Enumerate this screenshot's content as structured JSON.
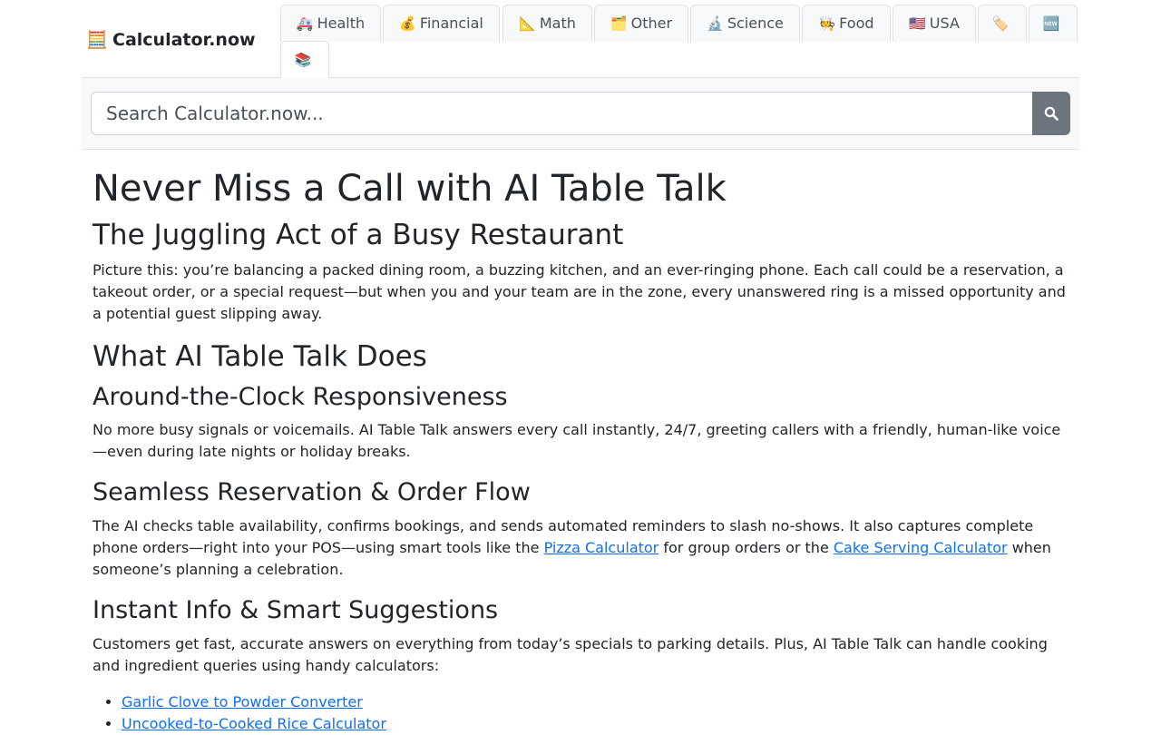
{
  "brand": {
    "icon": "🧮",
    "name": "Calculator.now"
  },
  "tabs": [
    {
      "icon": "🚑",
      "label": "Health",
      "name": "tab-health"
    },
    {
      "icon": "💰",
      "label": "Financial",
      "name": "tab-financial"
    },
    {
      "icon": "📐",
      "label": "Math",
      "name": "tab-math"
    },
    {
      "icon": "🗂️",
      "label": "Other",
      "name": "tab-other"
    },
    {
      "icon": "🔬",
      "label": "Science",
      "name": "tab-science"
    },
    {
      "icon": "🧑‍🍳",
      "label": "Food",
      "name": "tab-food"
    },
    {
      "icon": "🇺🇸",
      "label": "USA",
      "name": "tab-usa"
    },
    {
      "icon": "🏷️",
      "label": "",
      "name": "tab-tags"
    },
    {
      "icon": "🆕",
      "label": "",
      "name": "tab-new"
    },
    {
      "icon": "📚",
      "label": "",
      "name": "tab-books"
    }
  ],
  "search": {
    "placeholder": "Search Calculator.now...",
    "value": "",
    "icon": "search-icon"
  },
  "article": {
    "title": "Never Miss a Call with AI Table Talk",
    "section1_heading": "The Juggling Act of a Busy Restaurant",
    "section1_text": "Picture this: you’re balancing a packed dining room, a buzzing kitchen, and an ever-ringing phone. Each call could be a reservation, a takeout order, or a special request—but when you and your team are in the zone, every unanswered ring is a missed opportunity and a potential guest slipping away.",
    "section2_heading": "What AI Table Talk Does",
    "sub1_heading": "Around-the-Clock Responsiveness",
    "sub1_text": "No more busy signals or voicemails. AI Table Talk answers every call instantly, 24/7, greeting callers with a friendly, human-like voice—even during late nights or holiday breaks.",
    "sub2_heading": "Seamless Reservation & Order Flow",
    "sub2_text_before": "The AI checks table availability, confirms bookings, and sends automated reminders to slash no-shows. It also captures complete phone orders—right into your POS—using smart tools like the ",
    "sub2_link1": "Pizza Calculator",
    "sub2_text_middle": " for group orders or the ",
    "sub2_link2": "Cake Serving Calculator",
    "sub2_text_after": " when someone’s planning a celebration.",
    "sub3_heading": "Instant Info & Smart Suggestions",
    "sub3_text": "Customers get fast, accurate answers on everything from today’s specials to parking details. Plus, AI Table Talk can handle cooking and ingredient queries using handy calculators:",
    "links": [
      "Garlic Clove to Powder Converter",
      "Uncooked-to-Cooked Rice Calculator"
    ]
  }
}
